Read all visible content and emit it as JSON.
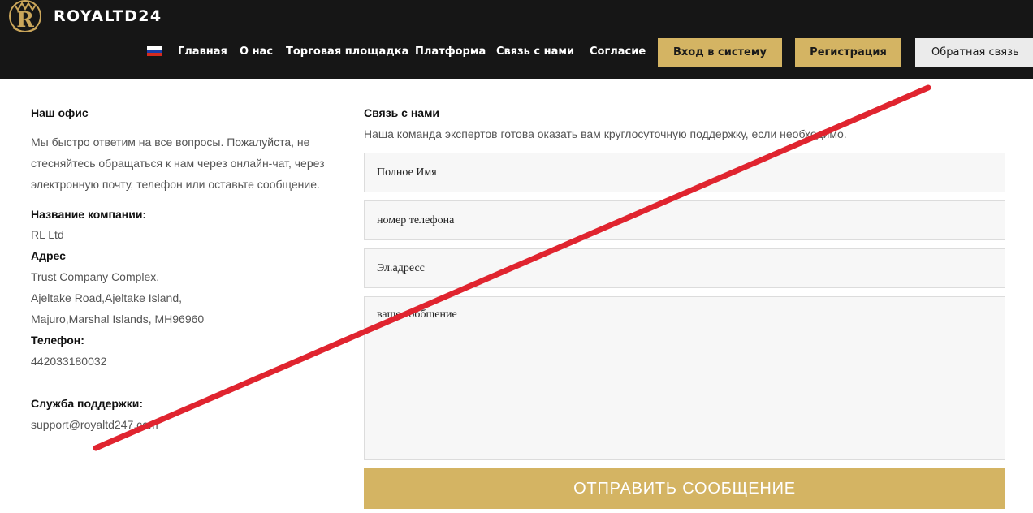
{
  "header": {
    "brand": "ROYALTD24",
    "logo_letter": "R",
    "nav": [
      "Главная",
      "О нас",
      "Торговая площадка",
      "Платформа",
      "Связь с нами",
      "Согласие"
    ],
    "login_button": "Вход в систему",
    "register_button": "Регистрация",
    "feedback_button": "Обратная связь",
    "colors": {
      "bar": "#161616",
      "gold": "#d4b463",
      "light": "#ebebeb"
    }
  },
  "office": {
    "title": "Наш офис",
    "intro": [
      "Мы быстро ответим на все вопросы. Пожалуйста, не",
      "стесняйтесь обращаться к нам через онлайн-чат, через",
      "электронную почту, телефон или оставьте сообщение."
    ],
    "company_label": "Название компании:",
    "company_value": "RL Ltd",
    "address_label": "Адрес",
    "address_lines": [
      "Trust Company Complex,",
      "Ajeltake Road,Ajeltake Island,",
      "Majuro,Marshal Islands, MH96960"
    ],
    "phone_label": "Телефон:",
    "phone_value": "442033180032",
    "support_label": "Служба поддержки:",
    "support_value": "support@royaltd247.com"
  },
  "contact": {
    "title": "Связь с нами",
    "subtitle": "Наша команда экспертов готова оказать вам круглосуточную поддержку, если необходимо.",
    "fields": [
      "Полное Имя",
      "номер телефона",
      "Эл.адресс"
    ],
    "message_placeholder": "ваше сообщение",
    "submit": "ОТПРАВИТЬ СООБЩЕНИЕ"
  },
  "overlay": {
    "strike_color": "#e0242f"
  }
}
